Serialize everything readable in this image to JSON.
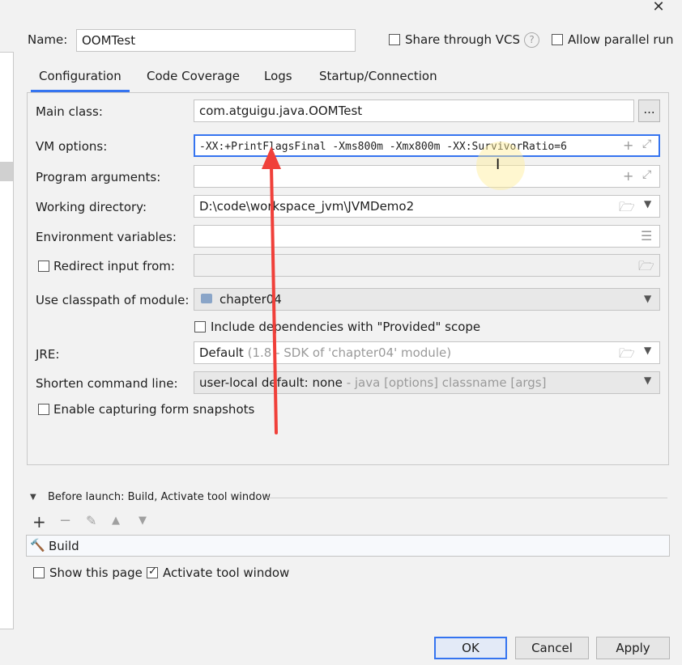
{
  "dialog": {
    "name_label": "Name:",
    "name_value": "OOMTest",
    "share_vcs_label": "Share through VCS",
    "help_icon": "?",
    "allow_parallel_label": "Allow parallel run"
  },
  "tabs": [
    {
      "label": "Configuration",
      "active": true
    },
    {
      "label": "Code Coverage"
    },
    {
      "label": "Logs"
    },
    {
      "label": "Startup/Connection"
    }
  ],
  "config": {
    "main_class_label": "Main class:",
    "main_class_value": "com.atguigu.java.OOMTest",
    "browse_button": "...",
    "vm_options_label": "VM options:",
    "vm_options_value": "-XX:+PrintFlagsFinal -Xms800m -Xmx800m -XX:SurvivorRatio=6",
    "program_args_label": "Program arguments:",
    "program_args_value": "",
    "working_dir_label": "Working directory:",
    "working_dir_value": "D:\\code\\workspace_jvm\\JVMDemo2",
    "env_vars_label": "Environment variables:",
    "env_vars_value": "",
    "redirect_input_label": "Redirect input from:",
    "classpath_module_label": "Use classpath of module:",
    "classpath_module_value": "chapter04",
    "include_deps_label": "Include dependencies with \"Provided\" scope",
    "jre_label": "JRE:",
    "jre_value": "Default",
    "jre_hint": "(1.8 - SDK of 'chapter04' module)",
    "shorten_cmd_label": "Shorten command line:",
    "shorten_cmd_value": "user-local default: none",
    "shorten_cmd_hint": "- java [options] classname [args]",
    "enable_snapshots_label": "Enable capturing form snapshots"
  },
  "before_launch": {
    "title": "Before launch: Build, Activate tool window",
    "items": [
      "Build"
    ]
  },
  "footer": {
    "show_page_label": "Show this page",
    "activate_tool_label": "Activate tool window",
    "activate_tool_checked": true
  },
  "buttons": {
    "ok": "OK",
    "cancel": "Cancel",
    "apply": "Apply"
  },
  "colors": {
    "accent": "#3574f0",
    "annotation_arrow": "#f0403a"
  }
}
